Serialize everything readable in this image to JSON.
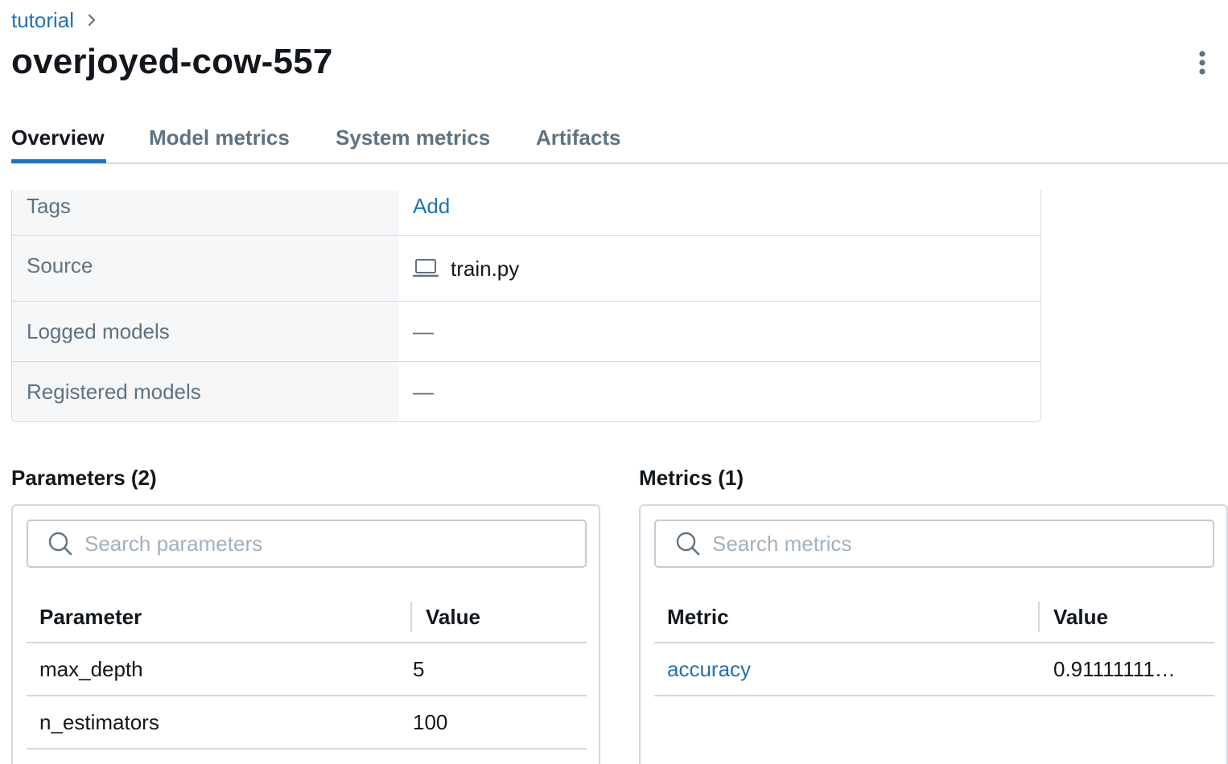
{
  "breadcrumb": {
    "experiment": "tutorial",
    "separator_icon": "chevron-right-icon"
  },
  "run_title": "overjoyed-cow-557",
  "tabs": [
    {
      "label": "Overview",
      "active": true
    },
    {
      "label": "Model metrics",
      "active": false
    },
    {
      "label": "System metrics",
      "active": false
    },
    {
      "label": "Artifacts",
      "active": false
    }
  ],
  "details": {
    "tags_label": "Tags",
    "tags_action": "Add",
    "source_label": "Source",
    "source_icon": "laptop-icon",
    "source_value": "train.py",
    "logged_models_label": "Logged models",
    "logged_models_value": "—",
    "registered_models_label": "Registered models",
    "registered_models_value": "—"
  },
  "parameters": {
    "title": "Parameters (2)",
    "search_placeholder": "Search parameters",
    "columns": [
      "Parameter",
      "Value"
    ],
    "rows": [
      {
        "name": "max_depth",
        "value": "5"
      },
      {
        "name": "n_estimators",
        "value": "100"
      }
    ]
  },
  "metrics": {
    "title": "Metrics (1)",
    "search_placeholder": "Search metrics",
    "columns": [
      "Metric",
      "Value"
    ],
    "rows": [
      {
        "name": "accuracy",
        "value": "0.91111111…"
      }
    ]
  },
  "colors": {
    "link": "#2272b4",
    "tab_active_underline": "#2272b4",
    "muted_text": "#5f7281",
    "border": "#d1d9e1"
  }
}
